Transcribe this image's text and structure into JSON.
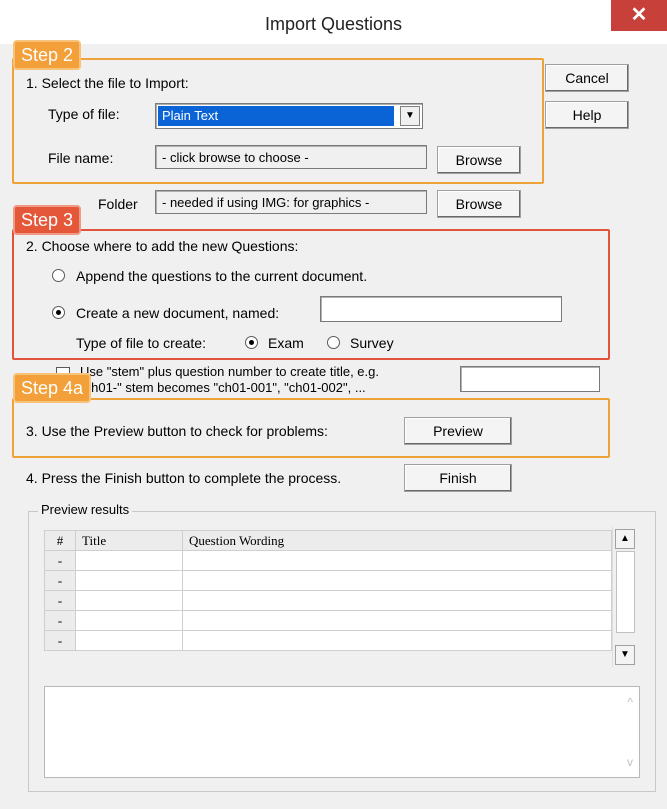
{
  "window": {
    "title": "Import Questions",
    "close": "✕"
  },
  "buttons": {
    "cancel": "Cancel",
    "help": "Help",
    "browse1": "Browse",
    "browse2": "Browse",
    "preview": "Preview",
    "finish": "Finish"
  },
  "steps": {
    "step2": "Step 2",
    "step3": "Step 3",
    "step4a": "Step 4a"
  },
  "section1": {
    "heading": "1.  Select the file to Import:",
    "type_label": "Type of file:",
    "type_value": "Plain Text",
    "file_label": "File name:",
    "file_value": "- click browse to choose -",
    "folder_label": "Folder",
    "folder_value": "- needed if using IMG: for graphics -"
  },
  "section2": {
    "heading": "2.  Choose where to add the new Questions:",
    "append": "Append the questions to the current document.",
    "create": "Create a new document, named:",
    "create_value": "",
    "type_label": "Type of file to create:",
    "exam": "Exam",
    "survey": "Survey"
  },
  "stem": {
    "line1": "Use \"stem\" plus question number to create title,  e.g.",
    "line2": "\"ch01-\" stem becomes \"ch01-001\",  \"ch01-002\",  ..."
  },
  "section3": {
    "text": "3.  Use the Preview button to check for problems:"
  },
  "section4": {
    "text": "4.  Press the Finish button to complete the process."
  },
  "preview": {
    "legend": "Preview results",
    "columns": [
      "#",
      "Title",
      "Question Wording"
    ],
    "rows": [
      {
        "num": "-",
        "title": "",
        "wording": ""
      },
      {
        "num": "-",
        "title": "",
        "wording": ""
      },
      {
        "num": "-",
        "title": "",
        "wording": ""
      },
      {
        "num": "-",
        "title": "",
        "wording": ""
      },
      {
        "num": "-",
        "title": "",
        "wording": ""
      }
    ]
  },
  "colors": {
    "step_orange": "#f3a03a",
    "step_red": "#e55739",
    "selection": "#0a64d6",
    "close_red": "#c7403a"
  }
}
